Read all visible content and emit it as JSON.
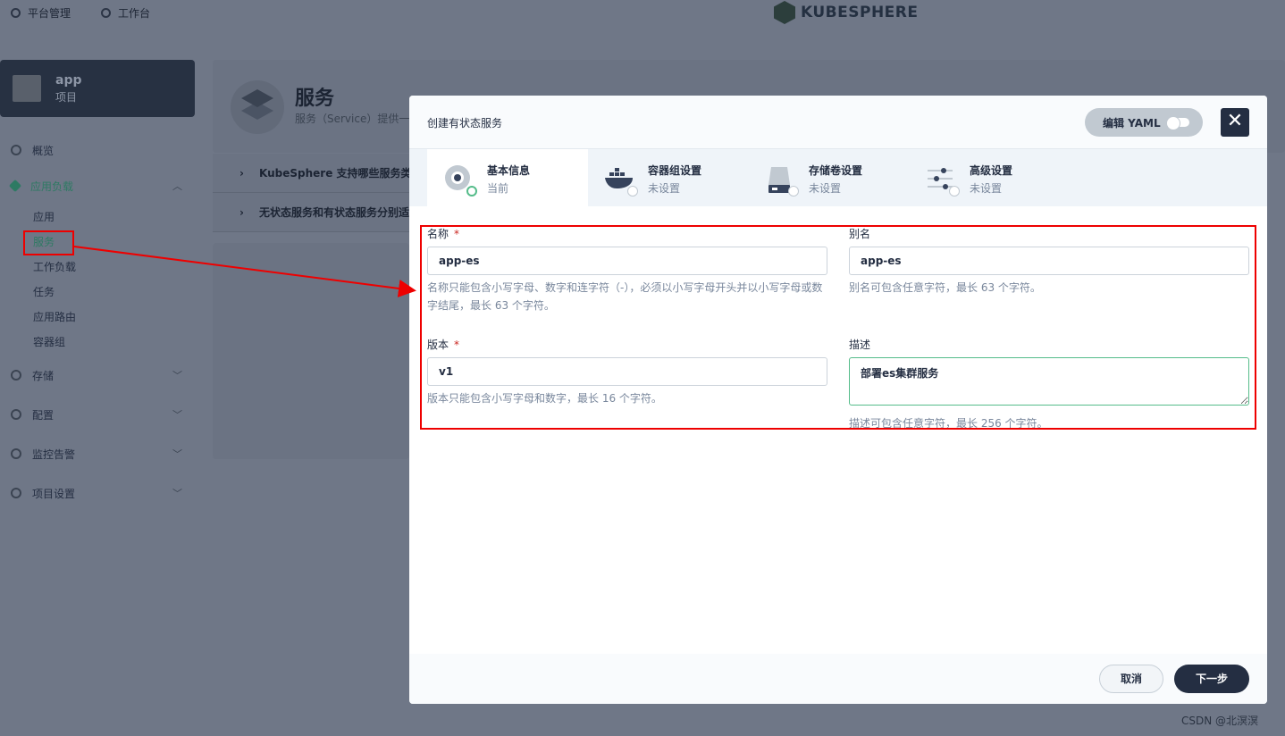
{
  "topbar": {
    "platform_label": "平台管理",
    "workbench_label": "工作台",
    "brand": "KUBESPHERE"
  },
  "project": {
    "name": "app",
    "type": "项目"
  },
  "sidebar": {
    "overview": "概览",
    "workloads_group": "应用负载",
    "workloads_items": [
      "应用",
      "服务",
      "工作负载",
      "任务",
      "应用路由",
      "容器组"
    ],
    "storage": "存储",
    "config": "配置",
    "monitoring": "监控告警",
    "project_settings": "项目设置"
  },
  "background_page": {
    "title": "服务",
    "description": "服务（Service）提供一种",
    "faq": [
      "KubeSphere 支持哪些服务类型？",
      "无状态服务和有状态服务分别适"
    ]
  },
  "modal": {
    "title": "创建有状态服务",
    "yaml_label": "编辑 YAML",
    "close_icon": "close-icon",
    "steps": [
      {
        "name": "基本信息",
        "status": "当前",
        "icon": "info-icon"
      },
      {
        "name": "容器组设置",
        "status": "未设置",
        "icon": "docker-icon"
      },
      {
        "name": "存储卷设置",
        "status": "未设置",
        "icon": "storage-icon"
      },
      {
        "name": "高级设置",
        "status": "未设置",
        "icon": "settings-icon"
      }
    ],
    "form": {
      "name_label": "名称",
      "name_required": "*",
      "name_value": "app-es",
      "name_desc": "名称只能包含小写字母、数字和连字符（-），必须以小写字母开头并以小写字母或数字结尾，最长 63 个字符。",
      "alias_label": "别名",
      "alias_value": "app-es",
      "alias_desc": "别名可包含任意字符，最长 63 个字符。",
      "version_label": "版本",
      "version_required": "*",
      "version_value": "v1",
      "version_desc": "版本只能包含小写字母和数字，最长 16 个字符。",
      "description_label": "描述",
      "description_value": "部署es集群服务",
      "description_desc": "描述可包含任意字符，最长 256 个字符。"
    },
    "cancel_label": "取消",
    "next_label": "下一步"
  },
  "watermark": "CSDN @北溟溟",
  "colors": {
    "accent_green": "#55bc8a",
    "dark": "#242e42",
    "highlight_red": "#ee0000"
  }
}
